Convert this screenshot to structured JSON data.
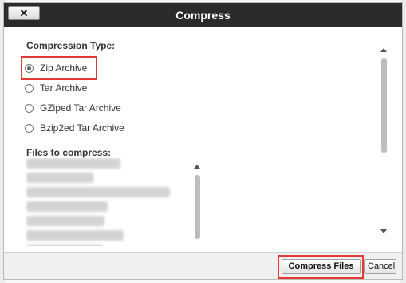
{
  "dialog": {
    "title": "Compress",
    "close_label": "✕"
  },
  "compression": {
    "section_label": "Compression Type:",
    "options": [
      {
        "label": "Zip Archive",
        "selected": true
      },
      {
        "label": "Tar Archive",
        "selected": false
      },
      {
        "label": "GZiped Tar Archive",
        "selected": false
      },
      {
        "label": "Bzip2ed Tar Archive",
        "selected": false
      }
    ]
  },
  "files": {
    "section_label": "Files to compress:"
  },
  "footer": {
    "compress_label": "Compress Files",
    "cancel_label": "Cancel"
  },
  "colors": {
    "header_bg": "#2b2b2b",
    "highlight": "#e53935"
  }
}
